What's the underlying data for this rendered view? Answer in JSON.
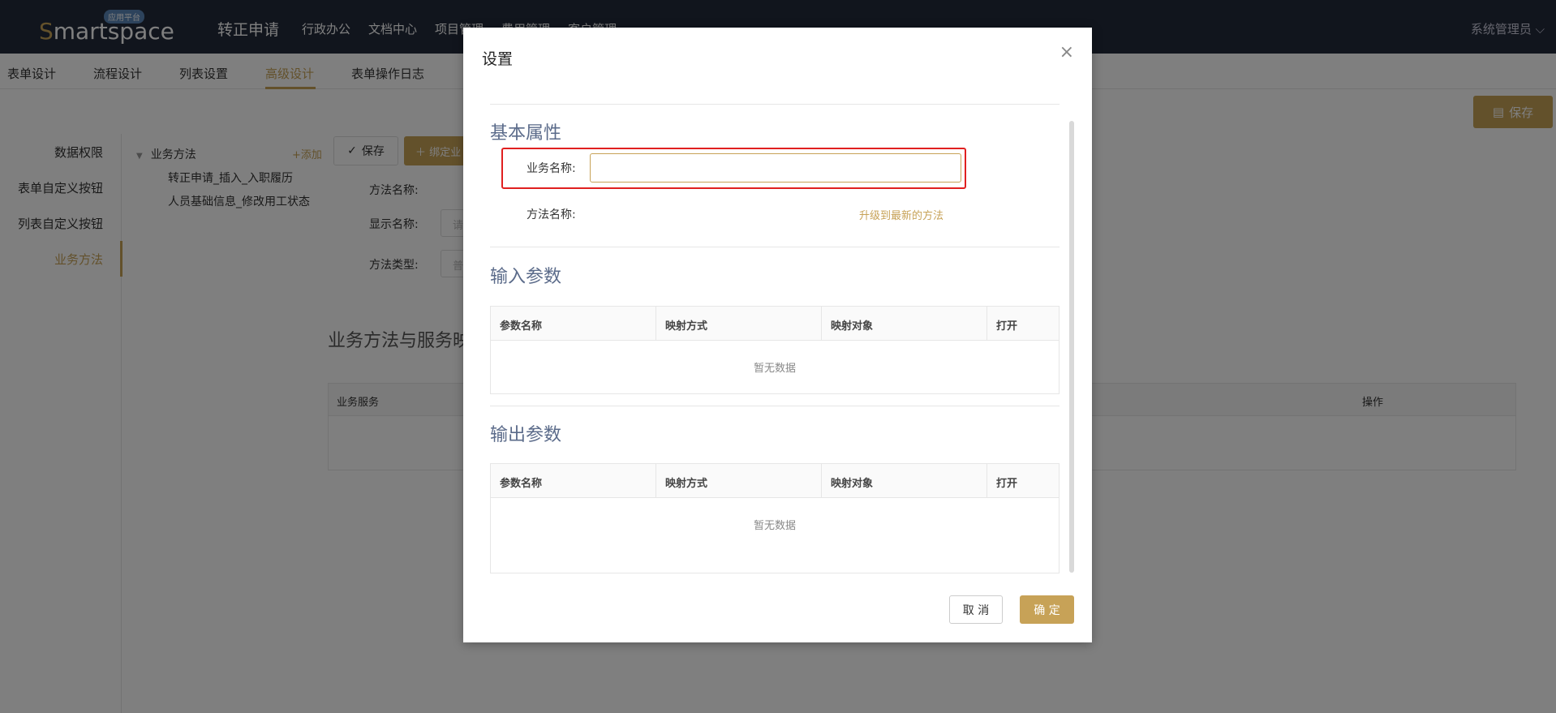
{
  "topbar": {
    "logo_text": "martspace",
    "logo_s": "S",
    "logo_badge": "应用平台",
    "app_title": "转正申请",
    "nav": [
      "行政办公",
      "文档中心",
      "项目管理",
      "费用管理",
      "客户管理"
    ],
    "user": "系统管理员 ⌵"
  },
  "subnav": {
    "items": [
      "表单设计",
      "流程设计",
      "列表设置",
      "高级设计",
      "表单操作日志"
    ],
    "active_index": 3,
    "save_label": "保存"
  },
  "sidebar": {
    "items": [
      "数据权限",
      "表单自定义按钮",
      "列表自定义按钮",
      "业务方法"
    ],
    "active_index": 3
  },
  "tree": {
    "root": "业务方法",
    "add_label": "+添加",
    "children": [
      "转正申请_插入_入职履历",
      "人员基础信息_修改用工状态"
    ]
  },
  "background": {
    "save_btn": "保存",
    "bind_btn": "＋ 绑定业",
    "method_name_label": "方法名称:",
    "display_name_label": "显示名称:",
    "display_placeholder": "请",
    "method_type_label": "方法类型:",
    "method_type_placeholder": "普",
    "section_title": "业务方法与服务映",
    "table_col_service": "业务服务",
    "table_col_action": "操作"
  },
  "modal": {
    "title": "设置",
    "close": "×",
    "basic_section": "基本属性",
    "biz_name_label": "业务名称:",
    "biz_name_value": "",
    "method_name_label": "方法名称:",
    "upgrade_link": "升级到最新的方法",
    "input_section": "输入参数",
    "output_section": "输出参数",
    "param_headers": [
      "参数名称",
      "映射方式",
      "映射对象",
      "打开"
    ],
    "empty_text": "暂无数据",
    "cancel": "取 消",
    "ok": "确 定"
  }
}
